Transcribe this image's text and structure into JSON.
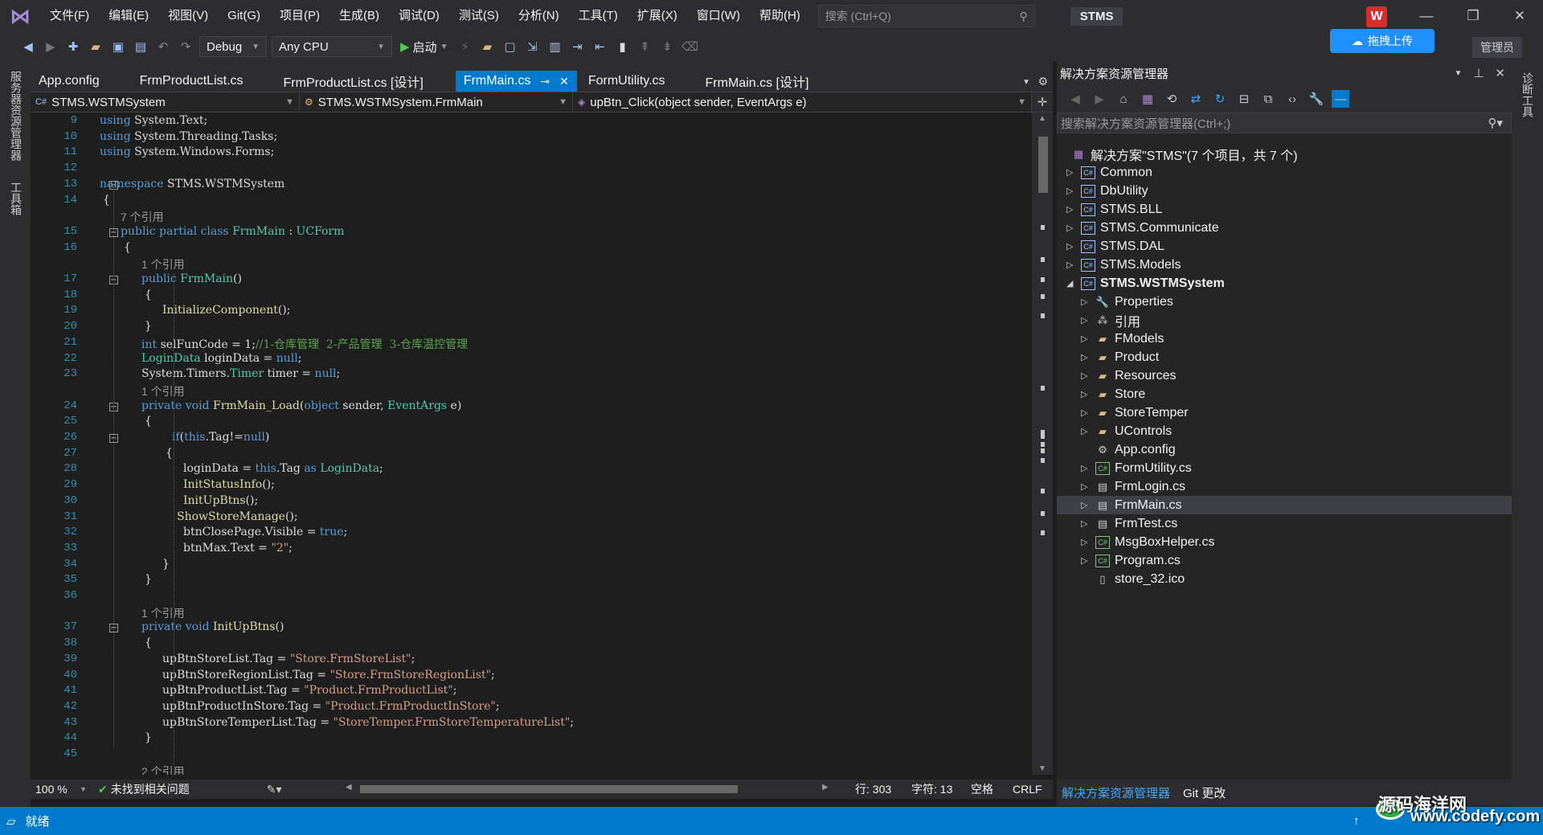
{
  "menubar": {
    "items": [
      "文件(F)",
      "编辑(E)",
      "视图(V)",
      "Git(G)",
      "项目(P)",
      "生成(B)",
      "调试(D)",
      "测试(S)",
      "分析(N)",
      "工具(T)",
      "扩展(X)",
      "窗口(W)",
      "帮助(H)"
    ],
    "search_placeholder": "搜索 (Ctrl+Q)",
    "solution_name": "STMS",
    "avatar_letter": "W"
  },
  "toolbar": {
    "config": "Debug",
    "platform": "Any CPU",
    "start_label": "启动",
    "upload_label": "拖拽上传",
    "admin_label": "管理员"
  },
  "left_strip": {
    "server_explorer": "服务器资源管理器",
    "toolbox": "工具箱"
  },
  "right_strip": {
    "diagnostics": "诊断工具"
  },
  "tabs": [
    "App.config",
    "FrmProductList.cs",
    "FrmProductList.cs [设计]",
    "FrmMain.cs",
    "FormUtility.cs",
    "FrmMain.cs [设计]"
  ],
  "navbar": {
    "project": "STMS.WSTMSystem",
    "class": "STMS.WSTMSystem.FrmMain",
    "member": "upBtn_Click(object sender, EventArgs e)"
  },
  "code": {
    "lines": [
      {
        "n": "9",
        "parts": [
          [
            "k",
            "using"
          ],
          [
            "p",
            " System.Text;"
          ]
        ]
      },
      {
        "n": "10",
        "parts": [
          [
            "k",
            "using"
          ],
          [
            "p",
            " System.Threading.Tasks;"
          ]
        ]
      },
      {
        "n": "11",
        "parts": [
          [
            "k",
            "using"
          ],
          [
            "p",
            " System.Windows.Forms;"
          ]
        ]
      },
      {
        "n": "12",
        "parts": []
      },
      {
        "n": "13",
        "parts": [
          [
            "k",
            "namespace"
          ],
          [
            "p",
            " STMS.WSTMSystem"
          ]
        ]
      },
      {
        "n": "14",
        "parts": [
          [
            "p",
            "{"
          ]
        ]
      },
      {
        "ref": "7 个引用"
      },
      {
        "n": "15",
        "parts": [
          [
            "k",
            "public partial class "
          ],
          [
            "t",
            "FrmMain"
          ],
          [
            "p",
            " : "
          ],
          [
            "t",
            "UCForm"
          ]
        ]
      },
      {
        "n": "16",
        "parts": [
          [
            "p",
            "{"
          ]
        ]
      },
      {
        "ref": "1 个引用"
      },
      {
        "n": "17",
        "parts": [
          [
            "k",
            "public "
          ],
          [
            "t",
            "FrmMain"
          ],
          [
            "p",
            "()"
          ]
        ]
      },
      {
        "n": "18",
        "parts": [
          [
            "p",
            "{"
          ]
        ]
      },
      {
        "n": "19",
        "parts": [
          [
            "m",
            "InitializeComponent"
          ],
          [
            "p",
            "();"
          ]
        ]
      },
      {
        "n": "20",
        "parts": [
          [
            "p",
            "}"
          ]
        ]
      },
      {
        "n": "21",
        "parts": [
          [
            "k",
            "int"
          ],
          [
            "p",
            " selFunCode = "
          ],
          [
            "p",
            "1"
          ],
          [
            "p",
            ";"
          ],
          [
            "c",
            "//1-仓库管理  2-产品管理  3-仓库温控管理"
          ]
        ]
      },
      {
        "n": "22",
        "parts": [
          [
            "t",
            "LoginData"
          ],
          [
            "p",
            " loginData = "
          ],
          [
            "k",
            "null"
          ],
          [
            "p",
            ";"
          ]
        ]
      },
      {
        "n": "23",
        "parts": [
          [
            "p",
            "System.Timers."
          ],
          [
            "t",
            "Timer"
          ],
          [
            "p",
            " timer = "
          ],
          [
            "k",
            "null"
          ],
          [
            "p",
            ";"
          ]
        ]
      },
      {
        "ref": "1 个引用"
      },
      {
        "n": "24",
        "parts": [
          [
            "k",
            "private void "
          ],
          [
            "m",
            "FrmMain_Load"
          ],
          [
            "p",
            "("
          ],
          [
            "k",
            "object"
          ],
          [
            "p",
            " sender, "
          ],
          [
            "t",
            "EventArgs"
          ],
          [
            "p",
            " e)"
          ]
        ]
      },
      {
        "n": "25",
        "parts": [
          [
            "p",
            "{"
          ]
        ]
      },
      {
        "n": "26",
        "parts": [
          [
            "k",
            "if"
          ],
          [
            "p",
            "("
          ],
          [
            "k",
            "this"
          ],
          [
            "p",
            ".Tag!="
          ],
          [
            "k",
            "null"
          ],
          [
            "p",
            ")"
          ]
        ]
      },
      {
        "n": "27",
        "parts": [
          [
            "p",
            "{"
          ]
        ]
      },
      {
        "n": "28",
        "parts": [
          [
            "p",
            "loginData = "
          ],
          [
            "k",
            "this"
          ],
          [
            "p",
            ".Tag "
          ],
          [
            "k",
            "as "
          ],
          [
            "t",
            "LoginData"
          ],
          [
            "p",
            ";"
          ]
        ]
      },
      {
        "n": "29",
        "parts": [
          [
            "m",
            "InitStatusInfo"
          ],
          [
            "p",
            "();"
          ]
        ]
      },
      {
        "n": "30",
        "parts": [
          [
            "m",
            "InitUpBtns"
          ],
          [
            "p",
            "();"
          ]
        ]
      },
      {
        "n": "31",
        "parts": [
          [
            "m",
            "ShowStoreManage"
          ],
          [
            "p",
            "();"
          ]
        ]
      },
      {
        "n": "32",
        "parts": [
          [
            "p",
            "btnClosePage.Visible = "
          ],
          [
            "k",
            "true"
          ],
          [
            "p",
            ";"
          ]
        ]
      },
      {
        "n": "33",
        "parts": [
          [
            "p",
            "btnMax.Text = "
          ],
          [
            "s",
            "\"2\""
          ],
          [
            "p",
            ";"
          ]
        ]
      },
      {
        "n": "34",
        "parts": [
          [
            "p",
            "}"
          ]
        ]
      },
      {
        "n": "35",
        "parts": [
          [
            "p",
            "}"
          ]
        ]
      },
      {
        "n": "36",
        "parts": []
      },
      {
        "ref": "1 个引用"
      },
      {
        "n": "37",
        "parts": [
          [
            "k",
            "private void "
          ],
          [
            "m",
            "InitUpBtns"
          ],
          [
            "p",
            "()"
          ]
        ]
      },
      {
        "n": "38",
        "parts": [
          [
            "p",
            "{"
          ]
        ]
      },
      {
        "n": "39",
        "parts": [
          [
            "p",
            "upBtnStoreList.Tag = "
          ],
          [
            "s",
            "\"Store.FrmStoreList\""
          ],
          [
            "p",
            ";"
          ]
        ]
      },
      {
        "n": "40",
        "parts": [
          [
            "p",
            "upBtnStoreRegionList.Tag = "
          ],
          [
            "s",
            "\"Store.FrmStoreRegionList\""
          ],
          [
            "p",
            ";"
          ]
        ]
      },
      {
        "n": "41",
        "parts": [
          [
            "p",
            "upBtnProductList.Tag = "
          ],
          [
            "s",
            "\"Product.FrmProductList\""
          ],
          [
            "p",
            ";"
          ]
        ]
      },
      {
        "n": "42",
        "parts": [
          [
            "p",
            "upBtnProductInStore.Tag = "
          ],
          [
            "s",
            "\"Product.FrmProductInStore\""
          ],
          [
            "p",
            ";"
          ]
        ]
      },
      {
        "n": "43",
        "parts": [
          [
            "p",
            "upBtnStoreTemperList.Tag = "
          ],
          [
            "s",
            "\"StoreTemper.FrmStoreTemperatureList\""
          ],
          [
            "p",
            ";"
          ]
        ]
      },
      {
        "n": "44",
        "parts": [
          [
            "p",
            "}"
          ]
        ]
      },
      {
        "n": "45",
        "parts": []
      },
      {
        "ref": "2 个引用"
      }
    ]
  },
  "editor_status": {
    "zoom": "100 %",
    "issues": "未找到相关问题",
    "line": "行: 303",
    "char": "字符: 13",
    "spacing": "空格",
    "eol": "CRLF"
  },
  "solution_explorer": {
    "title": "解决方案资源管理器",
    "search_placeholder": "搜索解决方案资源管理器(Ctrl+;)",
    "root": "解决方案\"STMS\"(7 个项目，共 7 个)",
    "nodes": [
      {
        "label": "Common",
        "icon": "csproj"
      },
      {
        "label": "DbUtility",
        "icon": "csproj"
      },
      {
        "label": "STMS.BLL",
        "icon": "csproj"
      },
      {
        "label": "STMS.Communicate",
        "icon": "csproj"
      },
      {
        "label": "STMS.DAL",
        "icon": "csproj"
      },
      {
        "label": "STMS.Models",
        "icon": "csproj"
      },
      {
        "label": "STMS.WSTMSystem",
        "icon": "csproj"
      },
      {
        "label": "Properties",
        "icon": "wrench"
      },
      {
        "label": "引用",
        "icon": "refs"
      },
      {
        "label": "FModels",
        "icon": "folder"
      },
      {
        "label": "Product",
        "icon": "folder"
      },
      {
        "label": "Resources",
        "icon": "folder"
      },
      {
        "label": "Store",
        "icon": "folder"
      },
      {
        "label": "StoreTemper",
        "icon": "folder"
      },
      {
        "label": "UControls",
        "icon": "folder"
      },
      {
        "label": "App.config",
        "icon": "config"
      },
      {
        "label": "FormUtility.cs",
        "icon": "cs"
      },
      {
        "label": "FrmLogin.cs",
        "icon": "form"
      },
      {
        "label": "FrmMain.cs",
        "icon": "form"
      },
      {
        "label": "FrmTest.cs",
        "icon": "form"
      },
      {
        "label": "MsgBoxHelper.cs",
        "icon": "cs"
      },
      {
        "label": "Program.cs",
        "icon": "cs"
      },
      {
        "label": "store_32.ico",
        "icon": "file"
      }
    ],
    "bottom_tabs": [
      "解决方案资源管理器",
      "Git 更改"
    ]
  },
  "statusbar": {
    "ready": "就绪"
  },
  "watermark": {
    "line1": "源码海洋网",
    "line2": "www.codefy.com"
  }
}
